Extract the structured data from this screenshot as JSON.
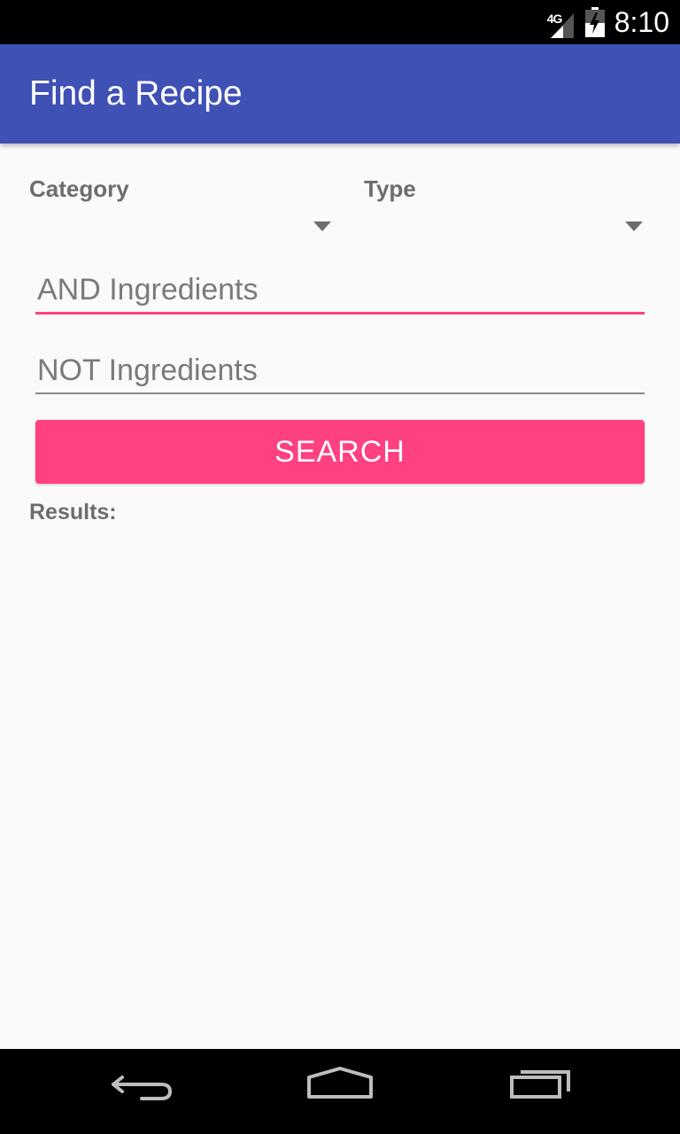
{
  "status_bar": {
    "network": "4G",
    "time": "8:10",
    "icons": [
      "signal-icon",
      "battery-icon"
    ]
  },
  "app_bar": {
    "title": "Find a Recipe"
  },
  "form": {
    "category_label": "Category",
    "type_label": "Type",
    "and_ingredients_placeholder": "AND Ingredients",
    "and_ingredients_value": "",
    "not_ingredients_placeholder": "NOT Ingredients",
    "not_ingredients_value": "",
    "search_label": "SEARCH",
    "results_label": "Results:"
  },
  "nav_bar": {
    "icons": [
      "back-icon",
      "home-icon",
      "recents-icon"
    ]
  },
  "colors": {
    "primary": "#3f51b5",
    "accent": "#ff4081",
    "background": "#fafafa",
    "label_gray": "#6d6d6d"
  }
}
